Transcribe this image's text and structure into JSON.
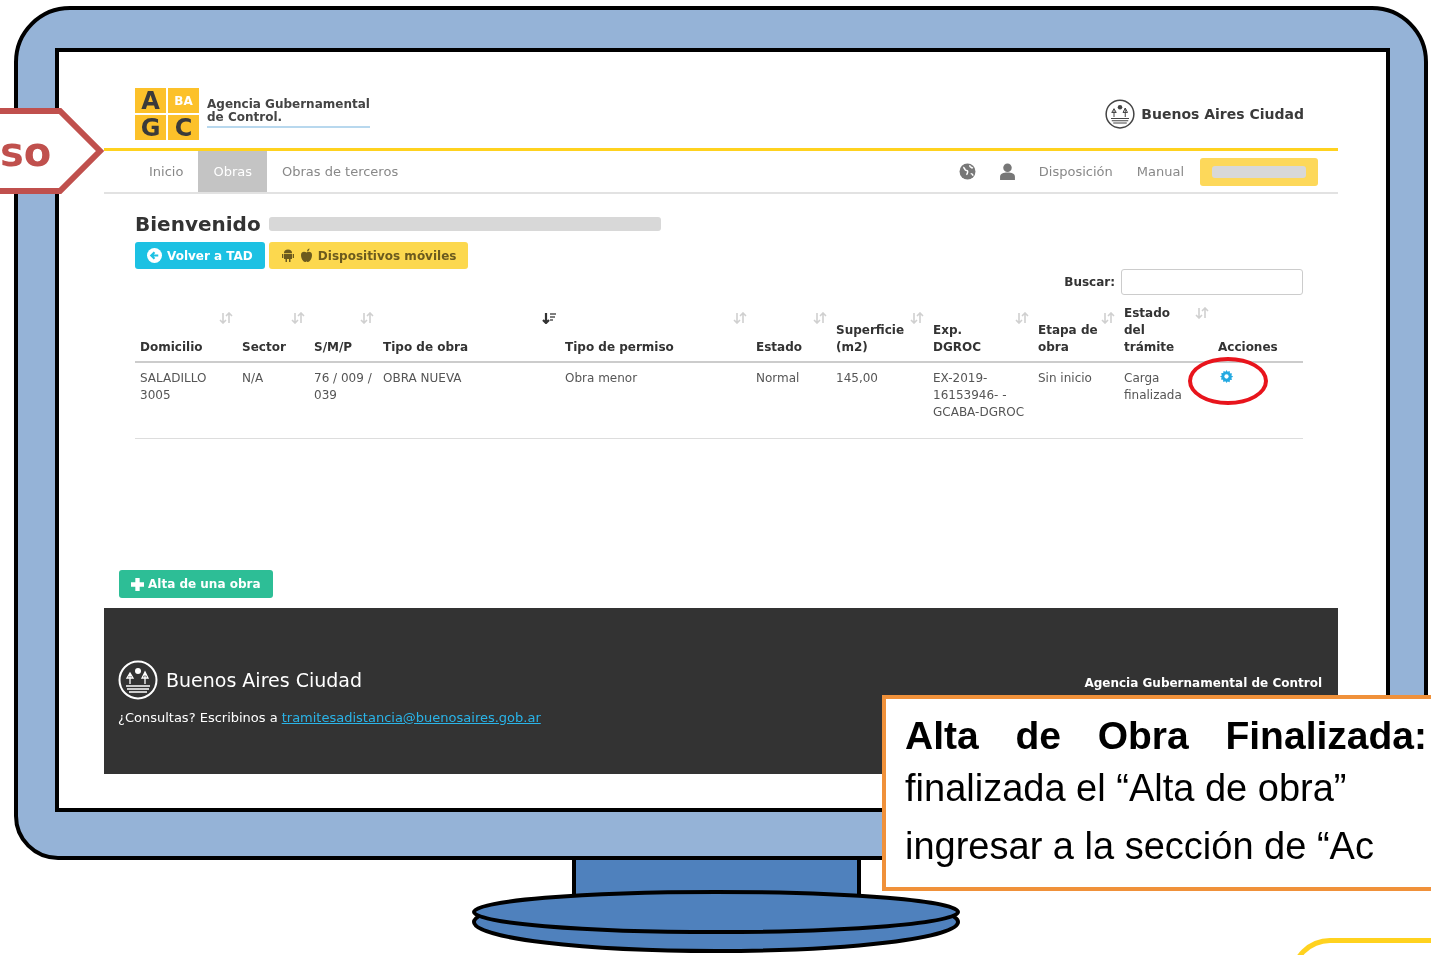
{
  "slide_tag": {
    "label": "so"
  },
  "site": {
    "logo": {
      "letters": [
        "A",
        "BA",
        "G",
        "C"
      ],
      "name_lines": [
        "Agencia Gubernamental",
        "de Control."
      ]
    },
    "brand": "Buenos Aires Ciudad",
    "nav": [
      {
        "label": "Inicio",
        "selected": false
      },
      {
        "label": "Obras",
        "selected": true
      },
      {
        "label": "Obras de terceros",
        "selected": false
      }
    ],
    "nav_right": [
      "Disposición",
      "Manual"
    ],
    "greeting": "Bienvenido",
    "buttons": [
      {
        "label": "Volver a TAD",
        "kind": "back"
      },
      {
        "label": "Dispositivos móviles",
        "kind": "mobile"
      }
    ],
    "search": {
      "label": "Buscar:"
    },
    "table": {
      "columns": [
        {
          "label": "Domicilio",
          "sortable": true,
          "sorted": false
        },
        {
          "label": "Sector",
          "sortable": true,
          "sorted": false
        },
        {
          "label": "S/M/P",
          "sortable": true,
          "sorted": false
        },
        {
          "label": "Tipo de obra",
          "sortable": true,
          "sorted": true
        },
        {
          "label": "Tipo de permiso",
          "sortable": true,
          "sorted": false
        },
        {
          "label": "Estado",
          "sortable": true,
          "sorted": false
        },
        {
          "label": "Superficie (m2)",
          "sortable": true,
          "sorted": false
        },
        {
          "label": "Exp. DGROC",
          "sortable": true,
          "sorted": false
        },
        {
          "label": "Etapa de obra",
          "sortable": true,
          "sorted": false
        },
        {
          "label": "Estado del trámite",
          "sortable": true,
          "sorted": false
        },
        {
          "label": "Acciones",
          "sortable": false,
          "sorted": false
        }
      ],
      "rows": [
        {
          "cells": [
            "SALADILLO 3005",
            "N/A",
            "76 / 009 / 039",
            "OBRA NUEVA",
            "Obra menor",
            "Normal",
            "145,00",
            "EX-2019-16153946- -GCABA-DGROC",
            "Sin inicio",
            "Carga finalizada"
          ],
          "highlighted": true
        }
      ]
    },
    "add_button": "Alta de una obra",
    "footer": {
      "brand": "Buenos Aires Ciudad",
      "agency": "Agencia Gubernamental de Control",
      "contact": "¿Consultas? Escribinos a",
      "email": "tramitesadistancia@buenosaires.gob.ar"
    }
  },
  "callout": {
    "title": "Alta de Obra Finalizada:",
    "lines": [
      "finalizada el “Alta de obra”",
      "ingresar a la sección de “Ac"
    ]
  }
}
